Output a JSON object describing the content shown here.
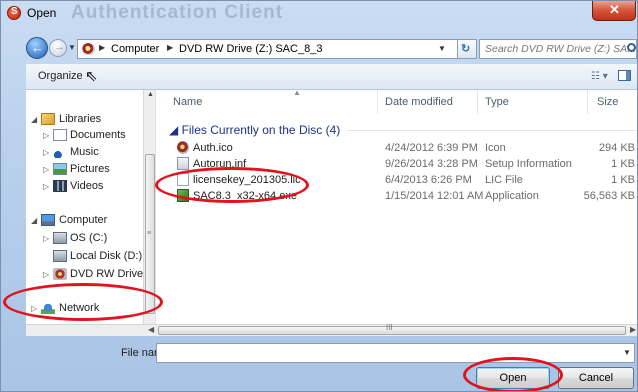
{
  "window": {
    "title": "Open",
    "background_title": "Authentication Client",
    "close_glyph": "✕"
  },
  "address": {
    "segments": [
      "Computer",
      "DVD RW Drive (Z:) SAC_8_3"
    ],
    "search_placeholder": "Search DVD RW Drive (Z:) SA..."
  },
  "toolbar": {
    "organize_label": "Organize",
    "help_glyph": "?"
  },
  "nav": {
    "libraries": "Libraries",
    "documents": "Documents",
    "music": "Music",
    "pictures": "Pictures",
    "videos": "Videos",
    "computer": "Computer",
    "os_c": "OS (C:)",
    "local_d": "Local Disk (D:)",
    "dvd": "DVD RW Drive (Z",
    "network": "Network"
  },
  "columns": {
    "name": "Name",
    "date": "Date modified",
    "type": "Type",
    "size": "Size"
  },
  "group_header": "Files Currently on the Disc (4)",
  "files": [
    {
      "name": "Auth.ico",
      "date": "4/24/2012 6:39 PM",
      "type": "Icon",
      "size": "294 KB",
      "icon": "ico-file-icon"
    },
    {
      "name": "Autorun.inf",
      "date": "9/26/2014 3:28 PM",
      "type": "Setup Information",
      "size": "1 KB",
      "icon": "setup-file-icon"
    },
    {
      "name": "licensekey_201305.lic",
      "date": "6/4/2013 6:26 PM",
      "type": "LIC File",
      "size": "1 KB",
      "icon": "license-file-icon"
    },
    {
      "name": "SAC8.3_x32-x64.exe",
      "date": "1/15/2014 12:01 AM",
      "type": "Application",
      "size": "56,563 KB",
      "icon": "exe-file-icon"
    }
  ],
  "bottom": {
    "filename_label": "File name:",
    "filename_value": "",
    "open_label": "Open",
    "cancel_label": "Cancel"
  },
  "colors": {
    "annotation": "#e0141e",
    "group_header": "#1e3287",
    "frame": "#b9d0ec"
  }
}
